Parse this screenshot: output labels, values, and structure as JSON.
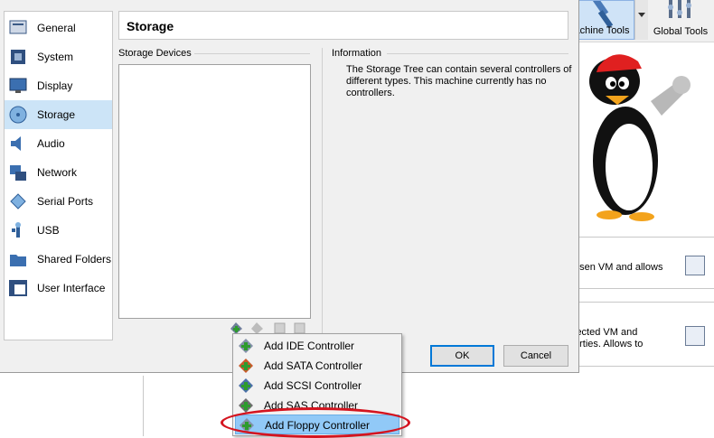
{
  "toolbar": {
    "machine_tools_label": "achine Tools",
    "global_tools_label": "Global Tools"
  },
  "bg_cards": {
    "card1_text": "osen VM and allows",
    "card2_line1": "lected VM and",
    "card2_line2": "erties. Allows to"
  },
  "sidebar": {
    "items": [
      {
        "label": "General",
        "icon": "general-icon"
      },
      {
        "label": "System",
        "icon": "system-icon"
      },
      {
        "label": "Display",
        "icon": "display-icon"
      },
      {
        "label": "Storage",
        "icon": "storage-icon"
      },
      {
        "label": "Audio",
        "icon": "audio-icon"
      },
      {
        "label": "Network",
        "icon": "network-icon"
      },
      {
        "label": "Serial Ports",
        "icon": "serial-ports-icon"
      },
      {
        "label": "USB",
        "icon": "usb-icon"
      },
      {
        "label": "Shared Folders",
        "icon": "shared-folders-icon"
      },
      {
        "label": "User Interface",
        "icon": "user-interface-icon"
      }
    ]
  },
  "page": {
    "title": "Storage",
    "storage_devices_label": "Storage Devices",
    "information_label": "Information",
    "information_text": "The Storage Tree can contain several controllers of different types. This machine currently has no controllers."
  },
  "buttons": {
    "ok": "OK",
    "cancel": "Cancel"
  },
  "menu": {
    "items": [
      {
        "label": "Add IDE Controller"
      },
      {
        "label": "Add SATA Controller"
      },
      {
        "label": "Add SCSI Controller"
      },
      {
        "label": "Add SAS Controller"
      },
      {
        "label": "Add Floppy Controller"
      }
    ],
    "highlighted_index": 4
  },
  "colors": {
    "selection": "#cce4f7",
    "menu_highlight": "#91c9f7",
    "annotation_red": "#d4141f"
  }
}
